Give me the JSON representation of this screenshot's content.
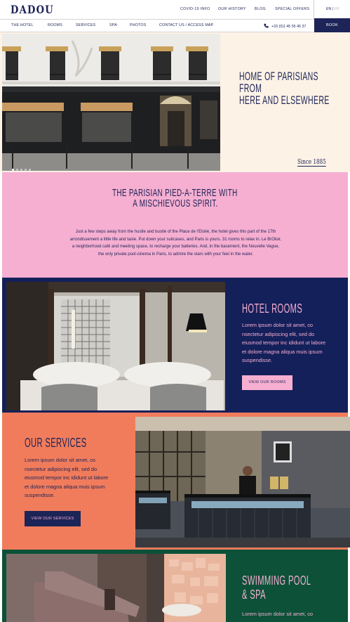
{
  "brand": {
    "logo": "DADOU"
  },
  "topnav": {
    "covid": "COVID-19 INFO",
    "history": "OUR HISTORY",
    "blog": "BLOG",
    "offers": "SPECIAL OFFERS"
  },
  "language": {
    "current": "EN",
    "separator": "|",
    "other": "FR"
  },
  "mainnav": {
    "items": [
      "THE HOTEL",
      "ROOMS",
      "SERVICES",
      "SPA",
      "PHOTOS",
      "CONTACT US / ACCESS MAP"
    ],
    "phone": "+33 (0)1 45 55 45 37",
    "book": "BOOK"
  },
  "hero": {
    "title_lines": [
      "HOME OF PARISIANS",
      "FROM",
      "HERE AND ELSEWHERE"
    ],
    "since": "Since 1885",
    "slides_total": 5,
    "slide_active": 1
  },
  "intro": {
    "title_lines": [
      "THE PARISIAN PIED-A-TERRE WITH",
      "A MISCHIEVOUS SPIRIT."
    ],
    "body": "Just a few steps away from the hustle and bustle of the Place de l’Etoile, the hotel gives this part of the 17th arrondissement a little life and taste. Put down your suitcases, and Paris is yours. 31 rooms to relax in. Le BrOloir, a neighborhood café and meeting space, to recharge your batteries. And, in the basement, the Nouvelle Vague, the only private pool-cinema in Paris, to admire the stars with your feet in the water."
  },
  "rooms": {
    "title": "HOTEL ROOMS",
    "body": "Lorem ipsum dolor sit amet, co nsectetur adipiscing elit, sed do eiusmod tempor inc ididunt ut labore et dolore magna aliqua muis ipsum suspendisse.",
    "button": "VIEW OUR ROOMS"
  },
  "services": {
    "title": "OUR SERVICES",
    "body": "Lorem ipsum dolor sit amet, co nsectetur adipiscing elit, sed do eiusmod tempor inc ididunt ut labore et dolore magna aliqua muis ipsum suspendisse.",
    "button": "VIEW OUR SERVICES"
  },
  "spa": {
    "title_lines": [
      "SWIMMING POOL",
      "& SPA"
    ],
    "body": "Lorem ipsum dolor sit amet, co"
  },
  "colors": {
    "navy": "#1d2457",
    "cream": "#fdf2e6",
    "pink": "#f6afd1",
    "rooms_bg": "#14205a",
    "coral": "#f17c5c",
    "green": "#0c5138"
  }
}
